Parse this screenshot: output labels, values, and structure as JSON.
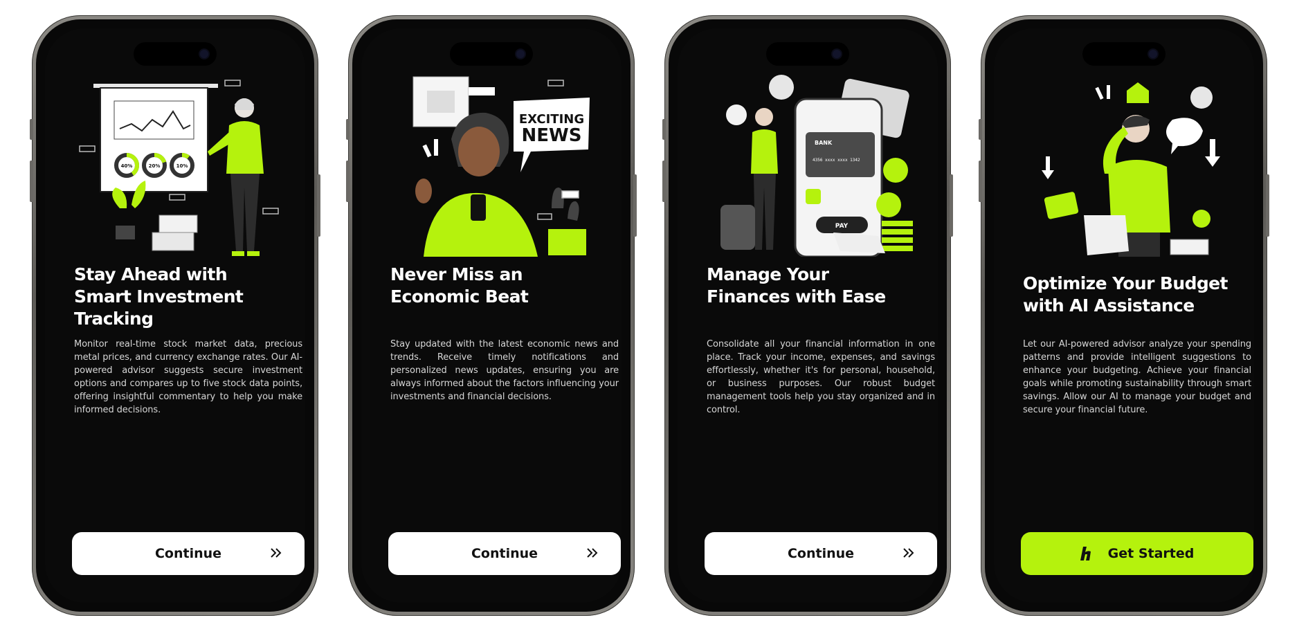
{
  "colors": {
    "accent": "#b5f20d",
    "screen": "#0a0a0a",
    "button": "#ffffff"
  },
  "screens": [
    {
      "title": [
        "Stay Ahead with",
        "Smart Investment",
        "Tracking"
      ],
      "description": "Monitor real-time stock market data, precious metal prices, and currency exchange rates. Our AI-powered advisor suggests secure investment options and compares up to five stock data points, offering insightful commentary to help you make informed decisions.",
      "button": "Continue",
      "illustration": {
        "pct1": "40%",
        "pct2": "20%",
        "pct3": "10%"
      }
    },
    {
      "title": [
        "Never Miss an",
        "Economic Beat"
      ],
      "description": "Stay updated with the latest economic news and trends. Receive timely notifications and personalized news updates, ensuring you are always informed about the factors influencing your investments and financial decisions.",
      "button": "Continue",
      "illustration": {
        "sign_line1": "EXCITING",
        "sign_line2": "NEWS"
      }
    },
    {
      "title": [
        "Manage Your",
        "Finances with Ease"
      ],
      "description": "Consolidate all your financial information in one place. Track your income, expenses, and savings effortlessly, whether it's for personal, household, or business purposes. Our robust budget management tools help you stay organized and in control.",
      "button": "Continue",
      "illustration": {
        "card_label": "BANK",
        "pay_label": "PAY",
        "card_number": "4356 xxxx xxxx 1342"
      }
    },
    {
      "title": [
        "Optimize Your Budget",
        "with AI Assistance"
      ],
      "description": "Let our AI-powered advisor analyze your spending patterns and provide intelligent suggestions to enhance your budgeting. Achieve your financial goals while promoting sustainability through smart savings. Allow our AI to manage your budget and secure your financial future.",
      "button": "Get Started",
      "illustration": {}
    }
  ]
}
